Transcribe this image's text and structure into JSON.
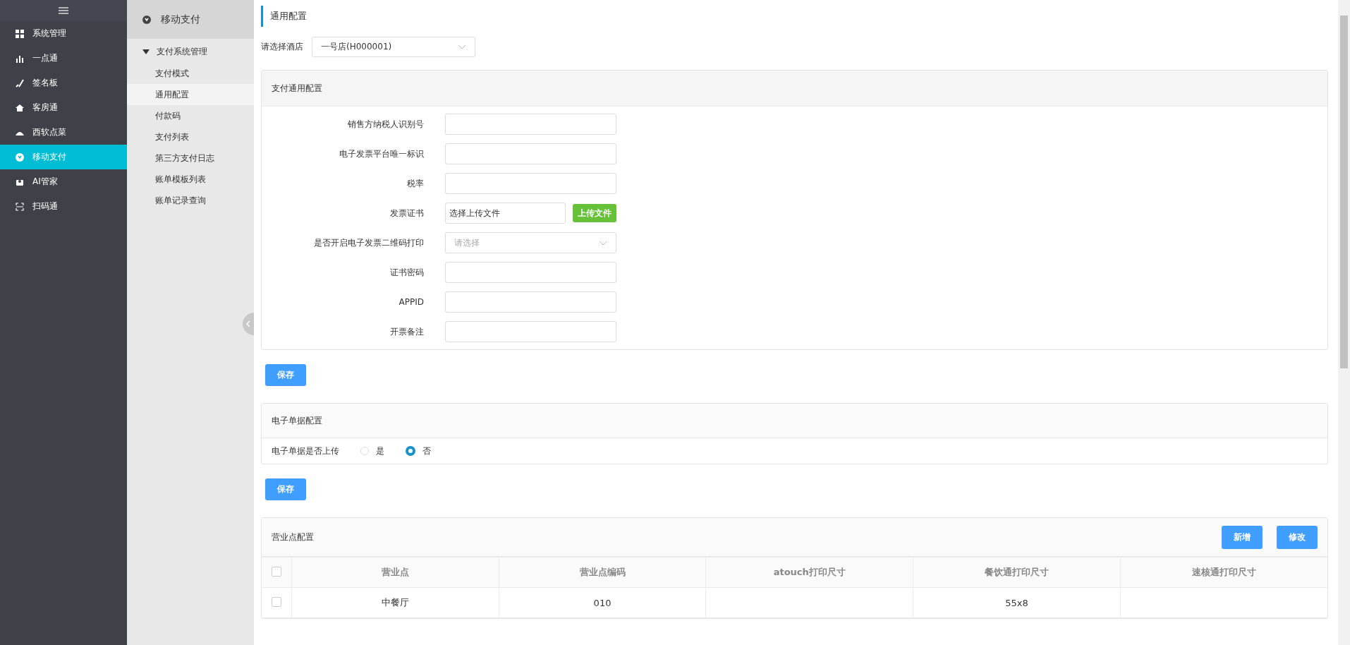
{
  "nav": {
    "items": [
      {
        "label": "系统管理",
        "selected": false
      },
      {
        "label": "一点通",
        "selected": false
      },
      {
        "label": "签名板",
        "selected": false
      },
      {
        "label": "客房通",
        "selected": false
      },
      {
        "label": "西软点菜",
        "selected": false
      },
      {
        "label": "移动支付",
        "selected": true
      },
      {
        "label": "AI管家",
        "selected": false
      },
      {
        "label": "扫码通",
        "selected": false
      }
    ]
  },
  "subnav": {
    "title": "移动支付",
    "group": {
      "label": "支付系统管理",
      "expanded": true,
      "children": [
        {
          "label": "支付模式",
          "selected": false
        },
        {
          "label": "通用配置",
          "selected": true
        },
        {
          "label": "付款码",
          "selected": false
        },
        {
          "label": "支付列表",
          "selected": false
        },
        {
          "label": "第三方支付日志",
          "selected": false
        },
        {
          "label": "账单模板列表",
          "selected": false
        },
        {
          "label": "账单记录查询",
          "selected": false
        }
      ]
    }
  },
  "page_title": "通用配置",
  "hotel": {
    "label": "请选择酒店",
    "value": "一号店(H000001)"
  },
  "general": {
    "title": "支付通用配置",
    "fields": [
      {
        "kind": "text",
        "label": "销售方纳税人识别号"
      },
      {
        "kind": "text",
        "label": "电子发票平台唯一标识"
      },
      {
        "kind": "text",
        "label": "税率"
      },
      {
        "kind": "file",
        "label": "发票证书",
        "value": "选择上传文件",
        "button": "上传文件"
      },
      {
        "kind": "select",
        "label": "是否开启电子发票二维码打印",
        "placeholder": "请选择"
      },
      {
        "kind": "text",
        "label": "证书密码"
      },
      {
        "kind": "text",
        "label": "APPID"
      },
      {
        "kind": "text",
        "label": "开票备注"
      }
    ],
    "save": "保存"
  },
  "receipt": {
    "title": "电子单据配置",
    "label": "电子单据是否上传",
    "options": [
      {
        "label": "是",
        "selected": false
      },
      {
        "label": "否",
        "selected": true
      }
    ],
    "save": "保存"
  },
  "outlets": {
    "title": "营业点配置",
    "buttons": [
      "新增",
      "修改"
    ],
    "table": {
      "all_checked": false,
      "columns": [
        "营业点",
        "营业点编码",
        "atouch打印尺寸",
        "餐饮通打印尺寸",
        "速核通打印尺寸"
      ],
      "rows": [
        {
          "checked": false,
          "cells": [
            "中餐厅",
            "010",
            "",
            "55x8",
            ""
          ]
        }
      ]
    }
  }
}
